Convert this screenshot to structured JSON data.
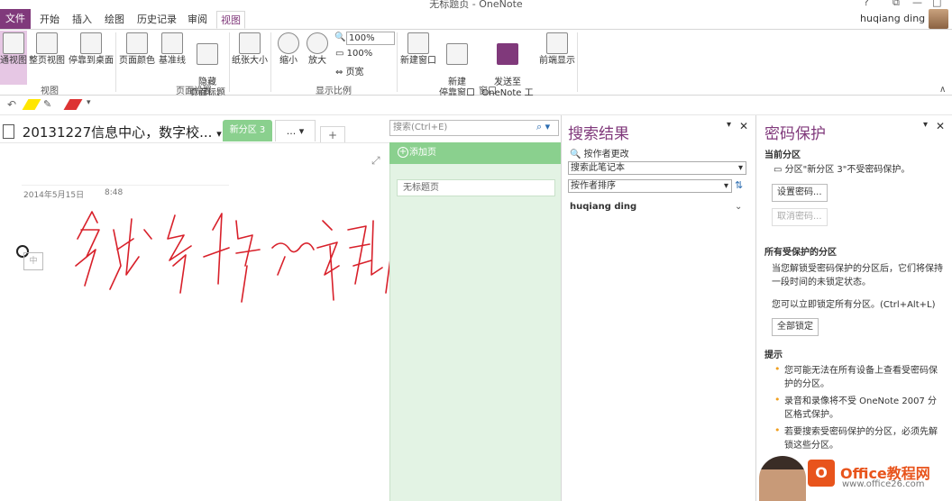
{
  "window": {
    "title": "无标题页 - OneNote",
    "help": "?",
    "restore": "⧉",
    "minimize": "—",
    "maximize": "□"
  },
  "menu": {
    "tabs": [
      "文件",
      "开始",
      "插入",
      "绘图",
      "历史记录",
      "审阅",
      "视图"
    ],
    "active": "视图",
    "user": "huqiang ding"
  },
  "ribbon": {
    "view_group": {
      "label": "视图",
      "buttons": [
        "通视图",
        "整页视图",
        "停靠到桌面"
      ]
    },
    "page_setup_group": {
      "label": "页面设置",
      "buttons": [
        "页面颜色",
        "基准线",
        "隐藏\n页面标题",
        "纸张大小"
      ]
    },
    "zoom_group": {
      "label": "显示比例",
      "buttons": [
        "缩小",
        "放大"
      ],
      "zoom_value": "100%",
      "zoom_100": "100%",
      "page_width": "页宽"
    },
    "window_group": {
      "label": "窗口",
      "buttons": [
        "新建窗口",
        "新建\n停靠窗口",
        "发送至\nOneNote 工具",
        "前端显示"
      ]
    }
  },
  "notebook": {
    "title": "20131227信息中心，数字校...",
    "section": "新分区 3",
    "more": "... ▾",
    "add": "+"
  },
  "page": {
    "date": "2014年5月15日",
    "time": "8:48",
    "ime": "中"
  },
  "pages_panel": {
    "search_placeholder": "搜索(Ctrl+E)",
    "add_page": "添加页",
    "page_title": "无标题页"
  },
  "search_pane": {
    "title": "搜索结果",
    "change_by_author": "按作者更改",
    "scope": "搜索此笔记本",
    "sort": "按作者排序",
    "user": "huqiang ding"
  },
  "password_pane": {
    "title": "密码保护",
    "current_section_heading": "当前分区",
    "current_section_text": "分区\"新分区 3\"不受密码保护。",
    "set_password": "设置密码...",
    "remove_password": "取消密码...",
    "all_protected_heading": "所有受保护的分区",
    "all_protected_text": "当您解锁受密码保护的分区后，它们将保持一段时间的未锁定状态。",
    "lock_text": "您可以立即锁定所有分区。(Ctrl+Alt+L)",
    "lock_all": "全部锁定",
    "tips_heading": "提示",
    "tips": [
      "您可能无法在所有设备上查看受密码保护的分区。",
      "录音和录像将不受 OneNote 2007 分区格式保护。",
      "若要搜索受密码保护的分区，必须先解锁这些分区。"
    ]
  },
  "watermark": {
    "logo": "O",
    "text1": "Office教程网",
    "text2": "www.office26.com"
  }
}
